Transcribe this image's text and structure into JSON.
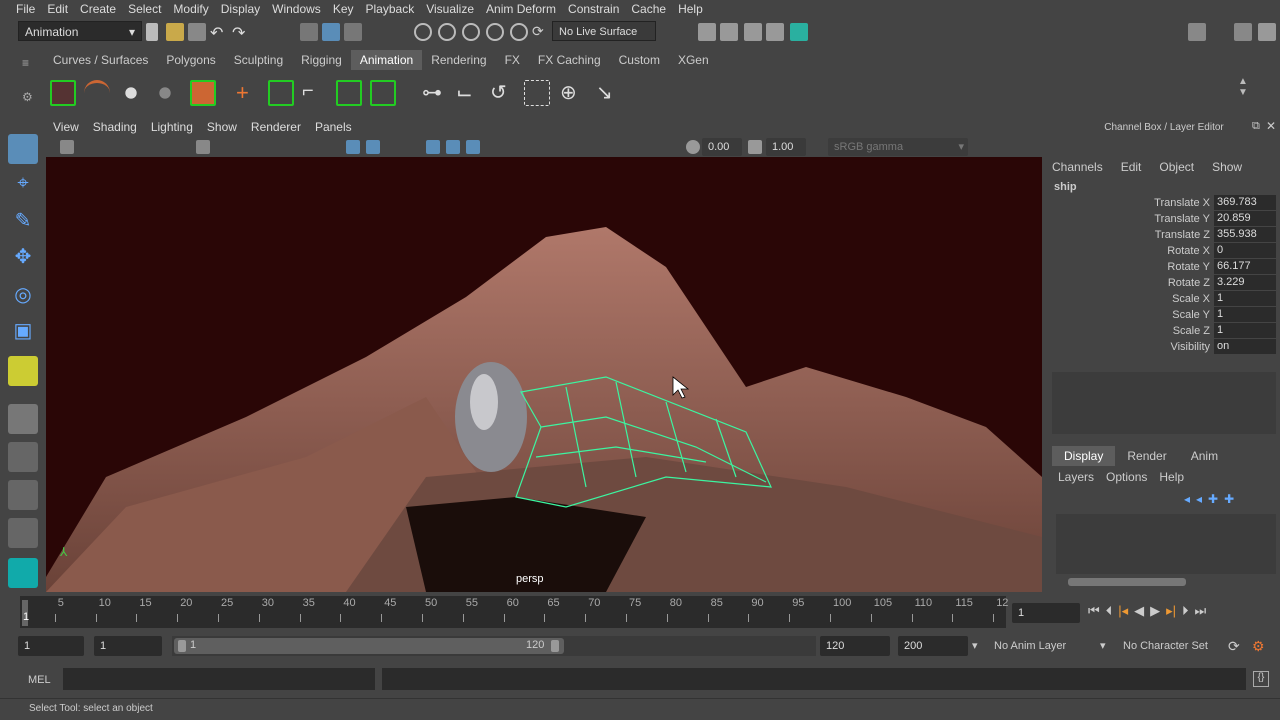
{
  "menu": [
    "File",
    "Edit",
    "Create",
    "Select",
    "Modify",
    "Display",
    "Windows",
    "Key",
    "Playback",
    "Visualize",
    "Anim Deform",
    "Constrain",
    "Cache",
    "Help"
  ],
  "status": {
    "mode": "Animation",
    "live_surface": "No Live Surface"
  },
  "shelf_tabs": [
    "Curves / Surfaces",
    "Polygons",
    "Sculpting",
    "Rigging",
    "Animation",
    "Rendering",
    "FX",
    "FX Caching",
    "Custom",
    "XGen"
  ],
  "active_shelf_tab": "Animation",
  "viewport": {
    "menu": [
      "View",
      "Shading",
      "Lighting",
      "Show",
      "Renderer",
      "Panels"
    ],
    "exposure": "0.00",
    "gamma": "1.00",
    "color_space": "sRGB gamma",
    "camera": "persp",
    "background_color": "#2a0606",
    "wireframe_color": "#3cf5a0"
  },
  "channel_box": {
    "title": "Channel Box / Layer Editor",
    "menu": [
      "Channels",
      "Edit",
      "Object",
      "Show"
    ],
    "object": "ship",
    "channels": [
      {
        "name": "Translate X",
        "value": "369.783"
      },
      {
        "name": "Translate Y",
        "value": "20.859"
      },
      {
        "name": "Translate Z",
        "value": "355.938"
      },
      {
        "name": "Rotate X",
        "value": "0"
      },
      {
        "name": "Rotate Y",
        "value": "66.177"
      },
      {
        "name": "Rotate Z",
        "value": "3.229"
      },
      {
        "name": "Scale X",
        "value": "1"
      },
      {
        "name": "Scale Y",
        "value": "1"
      },
      {
        "name": "Scale Z",
        "value": "1"
      },
      {
        "name": "Visibility",
        "value": "on"
      }
    ]
  },
  "layer_editor": {
    "tabs": [
      "Display",
      "Render",
      "Anim"
    ],
    "active_tab": "Display",
    "menu": [
      "Layers",
      "Options",
      "Help"
    ]
  },
  "time_slider": {
    "ticks": [
      "5",
      "10",
      "15",
      "20",
      "25",
      "30",
      "35",
      "40",
      "45",
      "50",
      "55",
      "60",
      "65",
      "70",
      "75",
      "80",
      "85",
      "90",
      "95",
      "100",
      "105",
      "110",
      "115",
      "12"
    ],
    "current_frame": "1",
    "current_frame_field": "1"
  },
  "range": {
    "start": "1",
    "playback_start": "1",
    "range_start_label": "1",
    "range_end_label": "120",
    "playback_end": "120",
    "end": "200",
    "anim_layer": "No Anim Layer",
    "character_set": "No Character Set"
  },
  "command_line": {
    "label": "MEL"
  },
  "help_line": "Select Tool: select an object"
}
